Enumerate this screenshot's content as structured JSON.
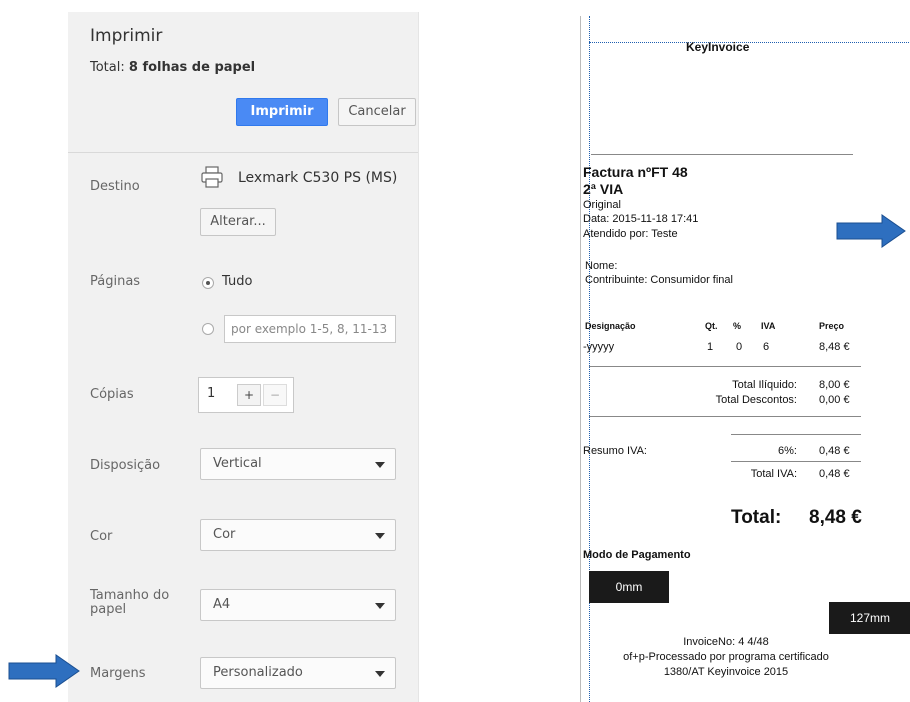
{
  "print_dialog": {
    "title": "Imprimir",
    "total_prefix": "Total:",
    "total_value": "8 folhas de papel",
    "print_button": "Imprimir",
    "cancel_button": "Cancelar",
    "destination_label": "Destino",
    "printer_name": "Lexmark C530 PS (MS)",
    "change_button": "Alterar...",
    "pages_label": "Páginas",
    "pages_all": "Tudo",
    "pages_placeholder": "por exemplo 1-5, 8, 11-13",
    "copies_label": "Cópias",
    "copies_value": "1",
    "copies_plus": "+",
    "copies_minus": "−",
    "layout_label": "Disposição",
    "layout_value": "Vertical",
    "color_label": "Cor",
    "color_value": "Cor",
    "paper_label": "Tamanho do papel",
    "paper_value": "A4",
    "margins_label": "Margens",
    "margins_value": "Personalizado"
  },
  "receipt": {
    "header": "KeyInvoice",
    "invoice_title": "Factura nºFT 48",
    "copy": "2ª VIA",
    "original": "Original",
    "date": "Data: 2015-11-18 17:41",
    "attended": "Atendido por: Teste",
    "name": "Nome:",
    "taxpayer": "Contribuinte: Consumidor final",
    "table": {
      "headers": [
        "Designação",
        "Qt.",
        "%",
        "IVA",
        "Preço"
      ],
      "row": [
        "-yyyyy",
        "1",
        "0",
        "6",
        "8,48 €"
      ]
    },
    "net_label": "Total Ilíquido:",
    "net_value": "8,00 €",
    "discount_label": "Total Descontos:",
    "discount_value": "0,00 €",
    "vat_summary_label": "Resumo IVA:",
    "vat_rate": "6%:",
    "vat_rate_value": "0,48 €",
    "vat_total_label": "Total IVA:",
    "vat_total_value": "0,48 €",
    "total_label": "Total:",
    "total_value": "8,48 €",
    "payment_label": "Modo de Pagamento",
    "margin_left_marker": "0mm",
    "margin_right_marker": "127mm",
    "footer_line1": "InvoiceNo: 4 4/48",
    "footer_line2": "of+p-Processado por programa certificado",
    "footer_line3": "1380/AT Keyinvoice 2015"
  },
  "colors": {
    "arrow": "#2e6fbf",
    "primary_button": "#4a8af4"
  }
}
